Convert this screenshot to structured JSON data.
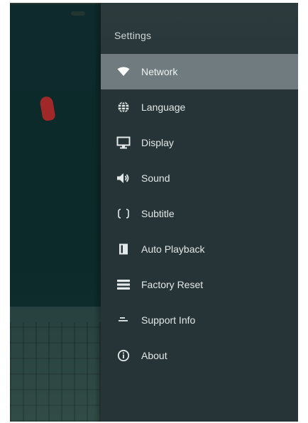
{
  "panel": {
    "title": "Settings",
    "active_index": 0,
    "items": [
      {
        "label": "Network",
        "icon": "wifi-icon"
      },
      {
        "label": "Language",
        "icon": "globe-icon"
      },
      {
        "label": "Display",
        "icon": "monitor-icon"
      },
      {
        "label": "Sound",
        "icon": "speaker-icon"
      },
      {
        "label": "Subtitle",
        "icon": "brackets-icon"
      },
      {
        "label": "Auto Playback",
        "icon": "playback-icon"
      },
      {
        "label": "Factory Reset",
        "icon": "reset-list-icon"
      },
      {
        "label": "Support Info",
        "icon": "support-icon"
      },
      {
        "label": "About",
        "icon": "info-icon"
      }
    ]
  },
  "colors": {
    "panel_bg": "#273437",
    "header_bg": "#2c3a3d",
    "active_bg": "#6f7b7e",
    "text": "#e3e8e8"
  }
}
